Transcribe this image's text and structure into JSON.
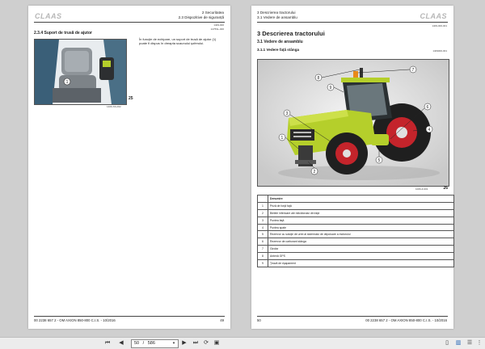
{
  "left_page": {
    "logo": "CLAAS",
    "header_line1": "2 Securitatea",
    "header_line2": "2.3 Dispozitive de siguranță",
    "ref_top1": "1409-000",
    "ref_top2": "1475SL-000",
    "section_title": "2.3.4 Suport de trusă de ajutor",
    "paragraph": "În funcţie de echipare, un suport de trusă de ajutor (1) poate fi dispus în dreapta scaunului şoferului.",
    "figure_number": "25",
    "figure_callout": "1",
    "figure_ref": "1406-SS-002",
    "footer_left": "00 2238 657 2 - OM AXION 850-800 C.I.S. - 10/2016",
    "footer_page": "49"
  },
  "right_page": {
    "logo": "CLAAS",
    "header_line1": "3 Descrierea tractorului",
    "header_line2": "3.1 Vedere de ansamblu",
    "ref_top": "1409-000-001",
    "chapter_title": "3 Descrierea tractorului",
    "section_title": "3.1 Vedere de ansamblu",
    "subsection_title": "3.1.1 Vedere faţă stânga",
    "ref_sub": "1409000-001",
    "figure_number": "26",
    "figure_ref": "1006-Z-001",
    "callouts": [
      "1",
      "2",
      "3",
      "4",
      "5",
      "6",
      "7",
      "8",
      "9"
    ],
    "table_header": "Denumire",
    "table_rows": [
      {
        "n": "1",
        "label": "Priză de forţă faţă"
      },
      {
        "n": "2",
        "label": "Bielele inferioare ale ridicătorului din faţă"
      },
      {
        "n": "3",
        "label": "Puntea faţă"
      },
      {
        "n": "4",
        "label": "Puntea spate"
      },
      {
        "n": "5",
        "label": "Rezervor cu soluţie de uree al sistemului de depoluare a motorului"
      },
      {
        "n": "6",
        "label": "Rezervor de carburant stânga"
      },
      {
        "n": "7",
        "label": "Girofar"
      },
      {
        "n": "8",
        "label": "Antenă GPS"
      },
      {
        "n": "9",
        "label": "Ţeavă de eşapament"
      }
    ],
    "footer_page": "50",
    "footer_right": "00 2238 657 2 - OM AXION 850-800 C.I.S. - 10/2016"
  },
  "toolbar": {
    "current_page": "50",
    "page_separator": "/",
    "total_pages": "586"
  },
  "colors": {
    "tractor_green": "#b5cf2b",
    "tractor_red": "#c4242b",
    "background": "#cfcfcf"
  }
}
